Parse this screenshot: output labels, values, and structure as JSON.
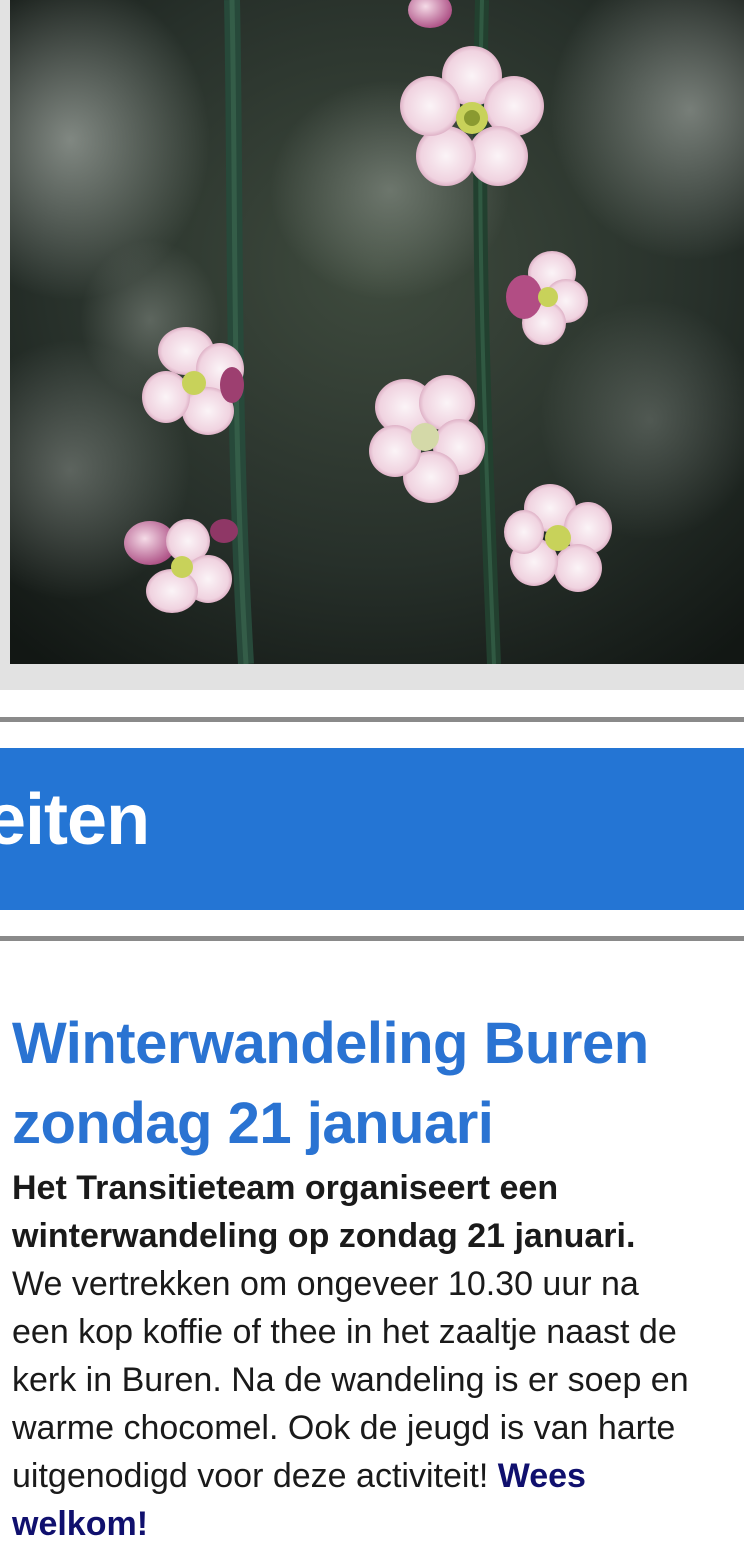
{
  "hero_image": {
    "alt": "Roze bloesem aan dunne groene takken"
  },
  "banner": {
    "title": "eiten"
  },
  "article": {
    "title_line1": "Winterwandeling Buren",
    "title_line2": "zondag 21 januari",
    "lead_line1": "Het Transitieteam organiseert een",
    "lead_line2": "winterwandeling op zondag 21 januari.",
    "body_line1": "We vertrekken om ongeveer 10.30 uur na",
    "body_line2": "een kop koffie of thee in het zaaltje naast de",
    "body_line3": "kerk in Buren. Na de wandeling is er soep en",
    "body_line4": "warme chocomel. Ook de jeugd is van harte",
    "body_line5": "uitgenodigd voor deze activiteit! ",
    "welcome_part1": "Wees",
    "welcome_part2": "welkom!"
  },
  "colors": {
    "banner_bg": "#2475d4",
    "title_blue": "#2a73d2",
    "welcome_navy": "#10106e",
    "rule_gray": "#8a8a8a"
  }
}
